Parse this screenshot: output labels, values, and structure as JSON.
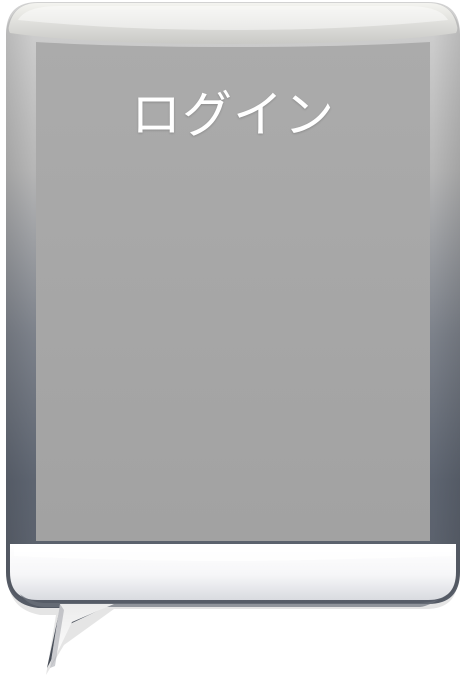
{
  "login_button": {
    "label": "ログイン"
  },
  "colors": {
    "face": "#a6a6a6",
    "frame_dark": "#5d6470",
    "frame_light": "#c4c4c4",
    "bottom_highlight": "#ffffff"
  }
}
